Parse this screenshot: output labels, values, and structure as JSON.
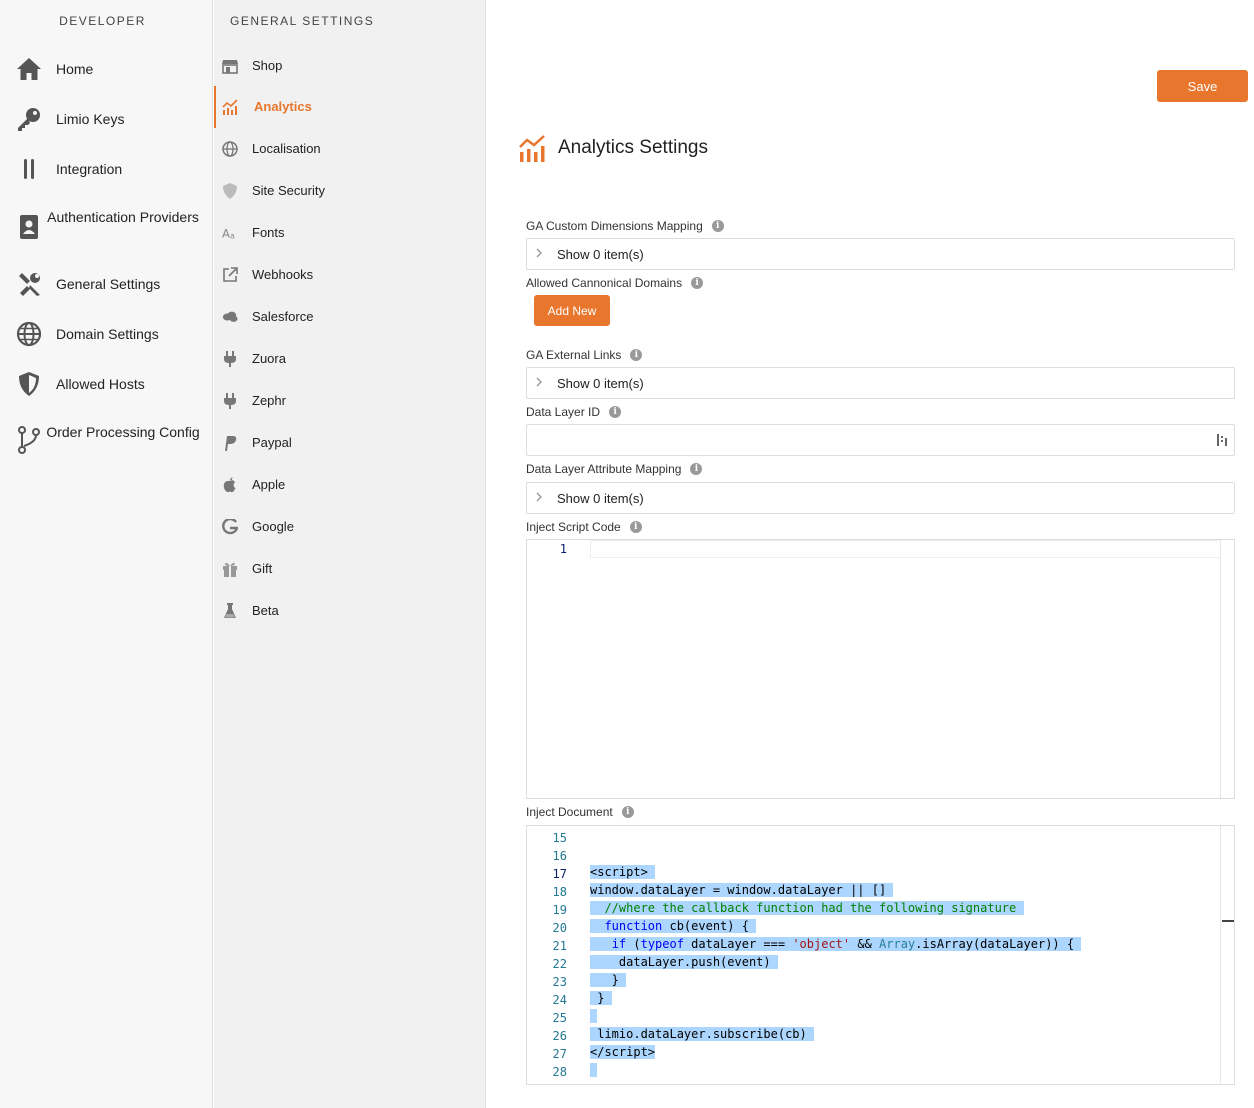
{
  "developer_sidebar": {
    "title": "DEVELOPER",
    "items": [
      {
        "label": "Home",
        "icon": "home-icon"
      },
      {
        "label": "Limio Keys",
        "icon": "key-icon"
      },
      {
        "label": "Integration",
        "icon": "integration-icon"
      },
      {
        "label": "Authentication Providers",
        "icon": "id-badge-icon"
      },
      {
        "label": "General Settings",
        "icon": "tools-icon"
      },
      {
        "label": "Domain Settings",
        "icon": "globe-icon"
      },
      {
        "label": "Allowed Hosts",
        "icon": "shield-icon"
      },
      {
        "label": "Order Processing Config",
        "icon": "branch-icon"
      }
    ]
  },
  "general_sidebar": {
    "title": "GENERAL SETTINGS",
    "active": "Analytics",
    "items": [
      {
        "label": "Shop",
        "icon": "shop-icon"
      },
      {
        "label": "Analytics",
        "icon": "analytics-icon"
      },
      {
        "label": "Localisation",
        "icon": "globe-icon"
      },
      {
        "label": "Site Security",
        "icon": "shield-icon"
      },
      {
        "label": "Fonts",
        "icon": "font-icon"
      },
      {
        "label": "Webhooks",
        "icon": "external-link-icon"
      },
      {
        "label": "Salesforce",
        "icon": "cloud-icon"
      },
      {
        "label": "Zuora",
        "icon": "plug-icon"
      },
      {
        "label": "Zephr",
        "icon": "plug-icon"
      },
      {
        "label": "Paypal",
        "icon": "paypal-icon"
      },
      {
        "label": "Apple",
        "icon": "apple-icon"
      },
      {
        "label": "Google",
        "icon": "google-icon"
      },
      {
        "label": "Gift",
        "icon": "gift-icon"
      },
      {
        "label": "Beta",
        "icon": "flask-icon"
      }
    ]
  },
  "main": {
    "save_label": "Save",
    "title": "Analytics Settings",
    "fields": {
      "ga_custom_dimensions": {
        "label": "GA Custom Dimensions Mapping",
        "summary": "Show 0 item(s)"
      },
      "allowed_domains": {
        "label": "Allowed Cannonical Domains",
        "button": "Add New"
      },
      "ga_external_links": {
        "label": "GA External Links",
        "summary": "Show 0 item(s)"
      },
      "data_layer_id": {
        "label": "Data Layer ID",
        "value": ""
      },
      "data_layer_attr": {
        "label": "Data Layer Attribute Mapping",
        "summary": "Show 0 item(s)"
      },
      "inject_script": {
        "label": "Inject Script Code",
        "line_numbers": [
          "1"
        ]
      },
      "inject_document": {
        "label": "Inject Document",
        "line_numbers": [
          "15",
          "16",
          "17",
          "18",
          "19",
          "20",
          "21",
          "22",
          "23",
          "24",
          "25",
          "26",
          "27",
          "28"
        ],
        "current_line": "17"
      }
    }
  },
  "colors": {
    "accent": "#e8762d",
    "selection": "#add6ff"
  }
}
